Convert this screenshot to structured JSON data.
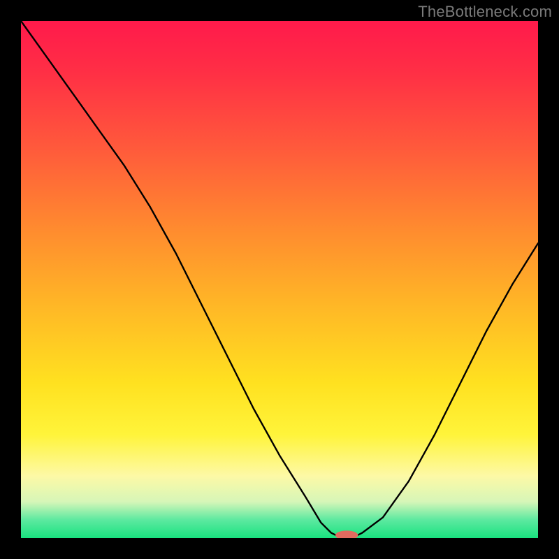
{
  "watermark": "TheBottleneck.com",
  "colors": {
    "black": "#000000",
    "curve": "#000000",
    "marker_fill": "#e26a5f",
    "gradient_stops": [
      {
        "offset": 0.0,
        "color": "#ff1a4b"
      },
      {
        "offset": 0.1,
        "color": "#ff2f45"
      },
      {
        "offset": 0.25,
        "color": "#ff5b3b"
      },
      {
        "offset": 0.4,
        "color": "#ff8a2f"
      },
      {
        "offset": 0.55,
        "color": "#ffb726"
      },
      {
        "offset": 0.7,
        "color": "#ffe120"
      },
      {
        "offset": 0.8,
        "color": "#fff43a"
      },
      {
        "offset": 0.88,
        "color": "#fdf9a6"
      },
      {
        "offset": 0.93,
        "color": "#d6f6b8"
      },
      {
        "offset": 0.965,
        "color": "#5ce9a0"
      },
      {
        "offset": 1.0,
        "color": "#19e27f"
      }
    ]
  },
  "chart_data": {
    "type": "line",
    "title": "",
    "xlabel": "",
    "ylabel": "",
    "xlim": [
      0,
      100
    ],
    "ylim": [
      0,
      100
    ],
    "grid": false,
    "legend": false,
    "series": [
      {
        "name": "bottleneck-curve",
        "x": [
          0,
          5,
          10,
          15,
          20,
          25,
          30,
          35,
          40,
          45,
          50,
          55,
          58,
          60,
          62,
          64,
          66,
          70,
          75,
          80,
          85,
          90,
          95,
          100
        ],
        "y": [
          100,
          93,
          86,
          79,
          72,
          64,
          55,
          45,
          35,
          25,
          16,
          8,
          3,
          1,
          0,
          0,
          1,
          4,
          11,
          20,
          30,
          40,
          49,
          57
        ]
      }
    ],
    "marker": {
      "x": 63,
      "y": 0,
      "rx": 2.2,
      "ry": 0.9
    }
  }
}
